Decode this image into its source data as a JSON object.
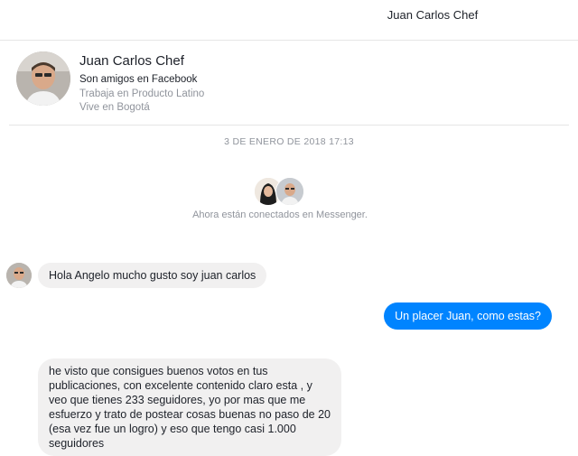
{
  "header": {
    "title": "Juan Carlos Chef"
  },
  "profile": {
    "name": "Juan Carlos Chef",
    "friends": "Son amigos en Facebook",
    "work": "Trabaja en Producto Latino",
    "location": "Vive en Bogotá"
  },
  "timestamp": "3 DE ENERO DE 2018 17:13",
  "connection": {
    "text": "Ahora están conectados en Messenger."
  },
  "messages": [
    {
      "from": "them",
      "text": "Hola  Angelo mucho gusto soy juan carlos"
    },
    {
      "from": "me",
      "text": "Un placer Juan, como estas?"
    },
    {
      "from": "them",
      "text": "he visto que consigues buenos votos en tus publicaciones, con excelente contenido claro esta , y veo que tienes 233 seguidores, yo por mas que me esfuerzo y trato de postear cosas buenas no paso de 20 (esa vez fue un logro) y eso que tengo casi 1.000 seguidores"
    }
  ],
  "colors": {
    "outgoing": "#0084ff",
    "incoming": "#f1f0f0",
    "muted": "#90949c"
  }
}
